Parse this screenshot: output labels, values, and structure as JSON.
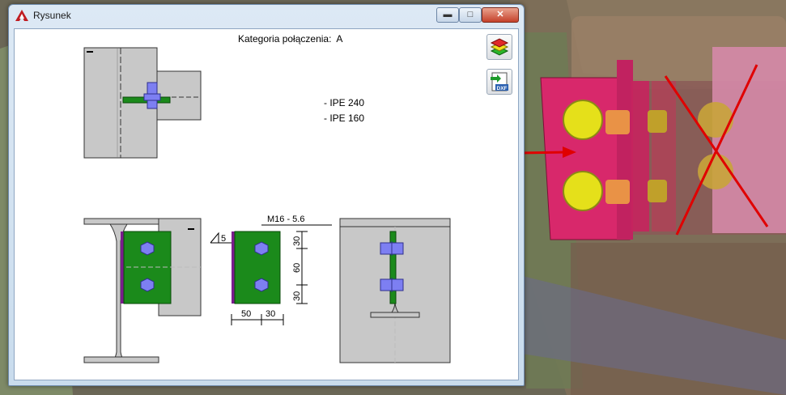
{
  "window": {
    "title": "Rysunek",
    "controls": {
      "minimize": "▬",
      "maximize": "□",
      "close": "✕"
    }
  },
  "drawing": {
    "category_text": "Kategoria połączenia:  A",
    "profiles": [
      "- IPE 240",
      "- IPE 160"
    ],
    "weld_size": "5",
    "bolt_label": "M16 - 5.6",
    "dims_vertical": [
      "30",
      "60",
      "30"
    ],
    "dims_horizontal": [
      "50",
      "30"
    ]
  },
  "toolbar": {
    "layers_icon": "layers-icon",
    "dxf_icon": "dxf-export-icon",
    "dxf_label": "DXF"
  },
  "colors": {
    "plate_green": "#1b8a1b",
    "bolt_blue": "#7d7ff2",
    "steel_gray": "#c8c8c8",
    "weld_purple": "#7a1d8c",
    "endplate_magenta": "#d8286b",
    "annotation_red": "#e00000"
  }
}
